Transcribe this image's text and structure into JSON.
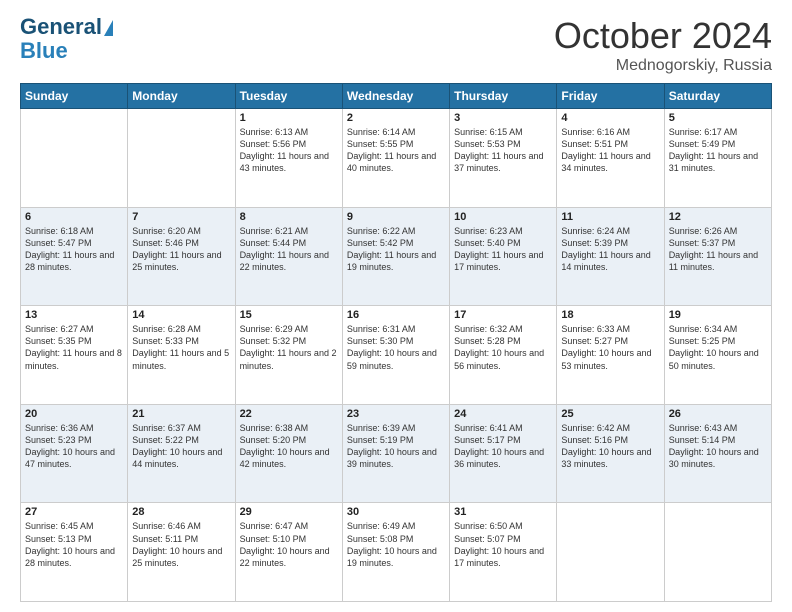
{
  "header": {
    "logo_line1": "General",
    "logo_line2": "Blue",
    "month": "October 2024",
    "location": "Mednogorskiy, Russia"
  },
  "days_of_week": [
    "Sunday",
    "Monday",
    "Tuesday",
    "Wednesday",
    "Thursday",
    "Friday",
    "Saturday"
  ],
  "weeks": [
    [
      {
        "day": "",
        "info": ""
      },
      {
        "day": "",
        "info": ""
      },
      {
        "day": "1",
        "info": "Sunrise: 6:13 AM\nSunset: 5:56 PM\nDaylight: 11 hours and 43 minutes."
      },
      {
        "day": "2",
        "info": "Sunrise: 6:14 AM\nSunset: 5:55 PM\nDaylight: 11 hours and 40 minutes."
      },
      {
        "day": "3",
        "info": "Sunrise: 6:15 AM\nSunset: 5:53 PM\nDaylight: 11 hours and 37 minutes."
      },
      {
        "day": "4",
        "info": "Sunrise: 6:16 AM\nSunset: 5:51 PM\nDaylight: 11 hours and 34 minutes."
      },
      {
        "day": "5",
        "info": "Sunrise: 6:17 AM\nSunset: 5:49 PM\nDaylight: 11 hours and 31 minutes."
      }
    ],
    [
      {
        "day": "6",
        "info": "Sunrise: 6:18 AM\nSunset: 5:47 PM\nDaylight: 11 hours and 28 minutes."
      },
      {
        "day": "7",
        "info": "Sunrise: 6:20 AM\nSunset: 5:46 PM\nDaylight: 11 hours and 25 minutes."
      },
      {
        "day": "8",
        "info": "Sunrise: 6:21 AM\nSunset: 5:44 PM\nDaylight: 11 hours and 22 minutes."
      },
      {
        "day": "9",
        "info": "Sunrise: 6:22 AM\nSunset: 5:42 PM\nDaylight: 11 hours and 19 minutes."
      },
      {
        "day": "10",
        "info": "Sunrise: 6:23 AM\nSunset: 5:40 PM\nDaylight: 11 hours and 17 minutes."
      },
      {
        "day": "11",
        "info": "Sunrise: 6:24 AM\nSunset: 5:39 PM\nDaylight: 11 hours and 14 minutes."
      },
      {
        "day": "12",
        "info": "Sunrise: 6:26 AM\nSunset: 5:37 PM\nDaylight: 11 hours and 11 minutes."
      }
    ],
    [
      {
        "day": "13",
        "info": "Sunrise: 6:27 AM\nSunset: 5:35 PM\nDaylight: 11 hours and 8 minutes."
      },
      {
        "day": "14",
        "info": "Sunrise: 6:28 AM\nSunset: 5:33 PM\nDaylight: 11 hours and 5 minutes."
      },
      {
        "day": "15",
        "info": "Sunrise: 6:29 AM\nSunset: 5:32 PM\nDaylight: 11 hours and 2 minutes."
      },
      {
        "day": "16",
        "info": "Sunrise: 6:31 AM\nSunset: 5:30 PM\nDaylight: 10 hours and 59 minutes."
      },
      {
        "day": "17",
        "info": "Sunrise: 6:32 AM\nSunset: 5:28 PM\nDaylight: 10 hours and 56 minutes."
      },
      {
        "day": "18",
        "info": "Sunrise: 6:33 AM\nSunset: 5:27 PM\nDaylight: 10 hours and 53 minutes."
      },
      {
        "day": "19",
        "info": "Sunrise: 6:34 AM\nSunset: 5:25 PM\nDaylight: 10 hours and 50 minutes."
      }
    ],
    [
      {
        "day": "20",
        "info": "Sunrise: 6:36 AM\nSunset: 5:23 PM\nDaylight: 10 hours and 47 minutes."
      },
      {
        "day": "21",
        "info": "Sunrise: 6:37 AM\nSunset: 5:22 PM\nDaylight: 10 hours and 44 minutes."
      },
      {
        "day": "22",
        "info": "Sunrise: 6:38 AM\nSunset: 5:20 PM\nDaylight: 10 hours and 42 minutes."
      },
      {
        "day": "23",
        "info": "Sunrise: 6:39 AM\nSunset: 5:19 PM\nDaylight: 10 hours and 39 minutes."
      },
      {
        "day": "24",
        "info": "Sunrise: 6:41 AM\nSunset: 5:17 PM\nDaylight: 10 hours and 36 minutes."
      },
      {
        "day": "25",
        "info": "Sunrise: 6:42 AM\nSunset: 5:16 PM\nDaylight: 10 hours and 33 minutes."
      },
      {
        "day": "26",
        "info": "Sunrise: 6:43 AM\nSunset: 5:14 PM\nDaylight: 10 hours and 30 minutes."
      }
    ],
    [
      {
        "day": "27",
        "info": "Sunrise: 6:45 AM\nSunset: 5:13 PM\nDaylight: 10 hours and 28 minutes."
      },
      {
        "day": "28",
        "info": "Sunrise: 6:46 AM\nSunset: 5:11 PM\nDaylight: 10 hours and 25 minutes."
      },
      {
        "day": "29",
        "info": "Sunrise: 6:47 AM\nSunset: 5:10 PM\nDaylight: 10 hours and 22 minutes."
      },
      {
        "day": "30",
        "info": "Sunrise: 6:49 AM\nSunset: 5:08 PM\nDaylight: 10 hours and 19 minutes."
      },
      {
        "day": "31",
        "info": "Sunrise: 6:50 AM\nSunset: 5:07 PM\nDaylight: 10 hours and 17 minutes."
      },
      {
        "day": "",
        "info": ""
      },
      {
        "day": "",
        "info": ""
      }
    ]
  ]
}
